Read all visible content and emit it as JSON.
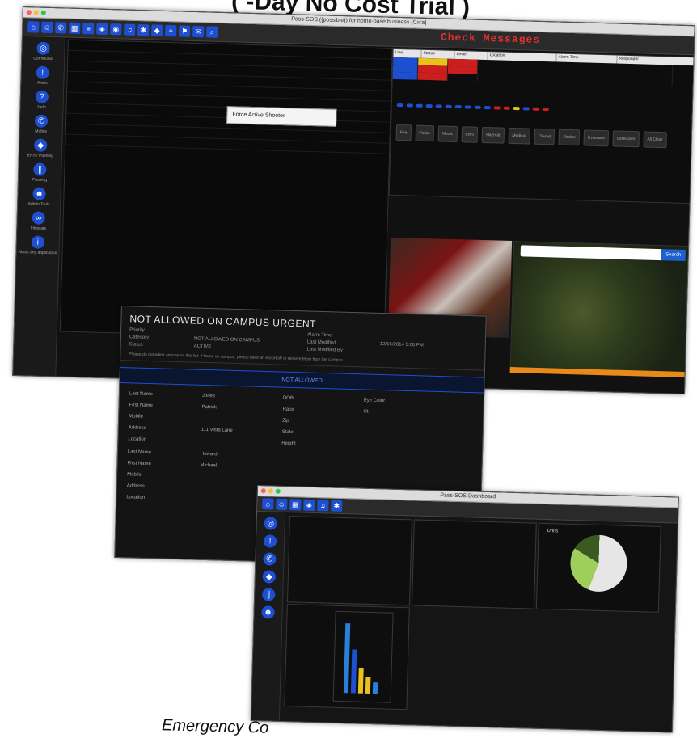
{
  "header": {
    "title": "( -Day No Cost Trial )"
  },
  "caption": "Emergency Co",
  "main_window": {
    "title": "Pass-SOS ({possible}) for home-base business [Cxra]",
    "check_messages": "Check Messages",
    "popup_label": "Force Active Shooter",
    "sidebar_items": [
      {
        "label": "Communic",
        "icon": "broadcast-icon"
      },
      {
        "label": "Alerts",
        "icon": "alert-icon"
      },
      {
        "label": "Help",
        "icon": "help-icon"
      },
      {
        "label": "Mobile",
        "icon": "phone-icon"
      },
      {
        "label": "ENS / Pushing",
        "icon": "shield-icon"
      },
      {
        "label": "Pausing",
        "icon": "pause-icon"
      },
      {
        "label": "Admin Tools",
        "icon": "users-icon"
      },
      {
        "label": "Integrate",
        "icon": "link-icon"
      },
      {
        "label": "About any application",
        "icon": "info-icon"
      }
    ],
    "table_headers": [
      "Line",
      "Status",
      "Level",
      "Location",
      "Alarm Time",
      "Responder"
    ],
    "status_chips": [
      {
        "label": "",
        "color": "#1e4fd0"
      },
      {
        "label": "",
        "color": "#cc1e1e"
      },
      {
        "label": "",
        "color": "#e6c21a"
      },
      {
        "label": "",
        "color": "#1e4fd0"
      },
      {
        "label": "",
        "color": "#1e4fd0"
      },
      {
        "label": "",
        "color": "#cc1e1e"
      },
      {
        "label": "",
        "color": "#cc1e1e"
      }
    ],
    "action_buttons": [
      "Fire",
      "Police",
      "Medic",
      "EMS",
      "Hazmat",
      "Medical",
      "Closed",
      "Shelter",
      "Evacuate",
      "Lockdown",
      "All Clear"
    ],
    "map_button": "Search"
  },
  "alert_window": {
    "title": "NOT ALLOWED ON CAMPUS URGENT",
    "fields": [
      [
        "Priority",
        "",
        "Alarm Time",
        ""
      ],
      [
        "Category",
        "NOT ALLOWED ON CAMPUS",
        "Last Modified",
        "12/16/2014 3:00 PM"
      ],
      [
        "Status",
        "ACTIVE",
        "Last Modified By",
        ""
      ]
    ],
    "note": "Please do not admit anyone on this list. If found on campus, please have an escort off or remove them from the campus.",
    "bar_label": "NOT ALLOWED",
    "person_fields": [
      [
        "Last Name",
        "Jones",
        "DOB",
        "Eye Color"
      ],
      [
        "First Name",
        "Patrick",
        "Race",
        "Ht"
      ],
      [
        "Mobile",
        "",
        "Zip",
        ""
      ],
      [
        "Address",
        "111 Vista Lane",
        "State",
        ""
      ],
      [
        "Location",
        "",
        "Height",
        ""
      ]
    ],
    "person2_fields": [
      [
        "Last Name",
        "Howard"
      ],
      [
        "First Name",
        "Michael"
      ],
      [
        "Mobile",
        ""
      ],
      [
        "Address",
        ""
      ],
      [
        "Location",
        ""
      ]
    ]
  },
  "dashboard_window": {
    "title": "Pass-SOS Dashboard",
    "pie_title": "Units",
    "bars": [
      {
        "value": 0.95,
        "color": "#2a7fd8"
      },
      {
        "value": 0.6,
        "color": "#1e4fd0"
      },
      {
        "value": 0.35,
        "color": "#e6c21a"
      },
      {
        "value": 0.22,
        "color": "#e6c21a"
      },
      {
        "value": 0.15,
        "color": "#2a7fd8"
      }
    ]
  }
}
